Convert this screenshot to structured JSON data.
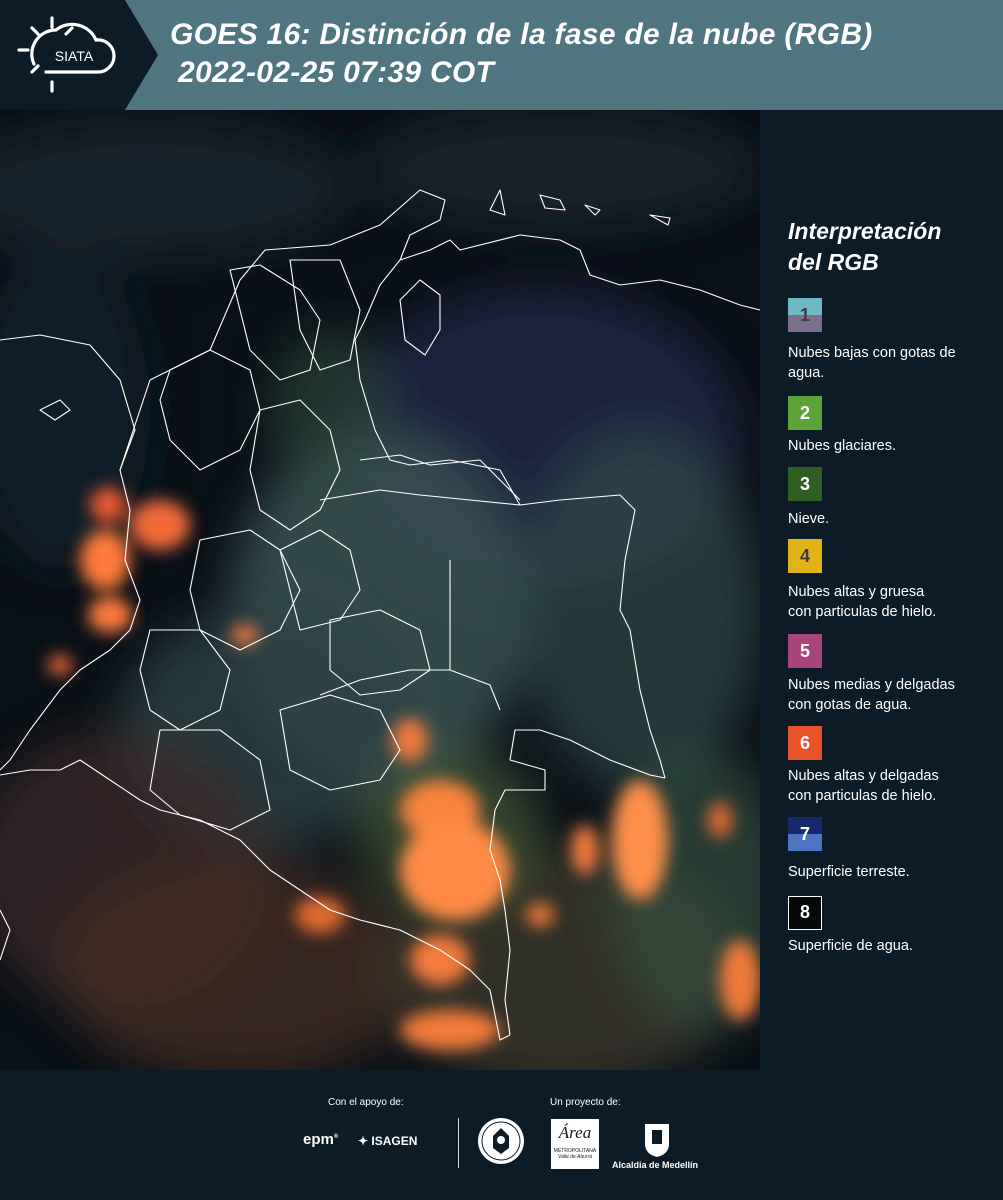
{
  "header": {
    "logo_text": "SIATA",
    "title_line1": "GOES 16: Distinción de la fase de la nube (RGB)",
    "title_line2": "2022-02-25 07:39 COT"
  },
  "legend": {
    "title_line1": "Interpretación",
    "title_line2": "del RGB",
    "items": [
      {
        "number": "1",
        "label_line1": "Nubes bajas con gotas de",
        "label_line2": "agua.",
        "color_top": "#6fb8c5",
        "color_bottom": "#7c6f8e"
      },
      {
        "number": "2",
        "label_line1": "Nubes glaciares.",
        "label_line2": "",
        "color_top": "#5ca33a",
        "color_bottom": "#5ca33a"
      },
      {
        "number": "3",
        "label_line1": "Nieve.",
        "label_line2": "",
        "color_top": "#2f5e22",
        "color_bottom": "#2f5e22"
      },
      {
        "number": "4",
        "label_line1": "Nubes altas y gruesa",
        "label_line2": "con particulas de hielo.",
        "color_top": "#e1b316",
        "color_bottom": "#e1b316"
      },
      {
        "number": "5",
        "label_line1": "Nubes medias y delgadas",
        "label_line2": "con gotas de agua.",
        "color_top": "#a7457c",
        "color_bottom": "#a7457c"
      },
      {
        "number": "6",
        "label_line1": "Nubes altas y delgadas",
        "label_line2": "con particulas de hielo.",
        "color_top": "#e8532a",
        "color_bottom": "#e8532a"
      },
      {
        "number": "7",
        "label_line1": "Superficie terreste.",
        "label_line2": "",
        "color_top": "#162a6b",
        "color_bottom": "#4d74c3"
      },
      {
        "number": "8",
        "label_line1": "Superficie de agua.",
        "label_line2": "",
        "color_top": "#050a08",
        "color_bottom": "#050a08"
      }
    ]
  },
  "footer": {
    "support_label": "Con el apoyo de:",
    "project_label": "Un proyecto de:",
    "sponsor1": "epm",
    "sponsor2": "ISAGEN",
    "partner_area_name": "Área",
    "partner_area_sub1": "METROPOLITANA",
    "partner_area_sub2": "Valle de Aburrá",
    "partner_alcaldia": "Alcaldía de Medellín"
  }
}
